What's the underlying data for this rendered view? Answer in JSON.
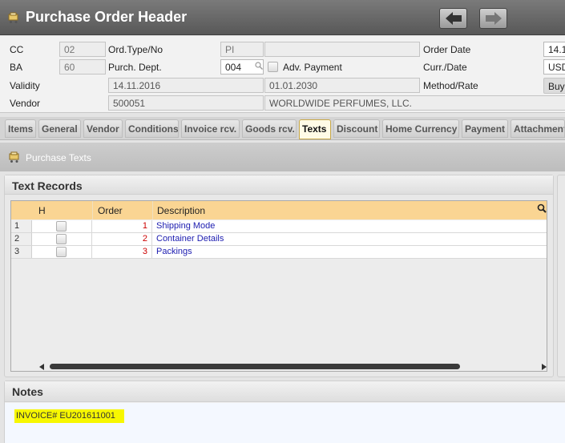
{
  "window": {
    "title": "Purchase Order Header",
    "back_icon": "arrow-left-icon",
    "forward_icon": "arrow-right-icon"
  },
  "header": {
    "cc_label": "CC",
    "cc_value": "02",
    "ba_label": "BA",
    "ba_value": "60",
    "ord_type_label": "Ord.Type/No",
    "ord_type_value": "PI",
    "ord_no_value": "",
    "purch_dept_label": "Purch. Dept.",
    "purch_dept_value": "004",
    "adv_payment_label": "Adv. Payment",
    "order_date_label": "Order Date",
    "order_date_value": "14.1",
    "curr_date_label": "Curr./Date",
    "curr_value": "USD",
    "validity_label": "Validity",
    "validity_from": "14.11.2016",
    "validity_to": "01.01.2030",
    "method_rate_label": "Method/Rate",
    "method_value": "Buy",
    "vendor_label": "Vendor",
    "vendor_code": "500051",
    "vendor_name": "WORLDWIDE PERFUMES, LLC."
  },
  "tabs": [
    {
      "label": "Items"
    },
    {
      "label": "General"
    },
    {
      "label": "Vendor"
    },
    {
      "label": "Conditions"
    },
    {
      "label": "Invoice rcv."
    },
    {
      "label": "Goods rcv."
    },
    {
      "label": "Texts",
      "active": true
    },
    {
      "label": "Discount"
    },
    {
      "label": "Home Currency"
    },
    {
      "label": "Payment"
    },
    {
      "label": "Attachment"
    }
  ],
  "section": {
    "title": "Purchase Texts"
  },
  "text_records": {
    "title": "Text Records",
    "columns": [
      "H",
      "Order",
      "Description"
    ],
    "rows": [
      {
        "num": "1",
        "order": "1",
        "description": "Shipping Mode"
      },
      {
        "num": "2",
        "order": "2",
        "description": "Container Details"
      },
      {
        "num": "3",
        "order": "3",
        "description": "Packings"
      }
    ]
  },
  "notes": {
    "title": "Notes",
    "text": "INVOICE# EU201611001",
    "highlight_color": "#f7f700"
  },
  "colors": {
    "grid_header": "#fad593",
    "order_value": "#cc0000",
    "description_link": "#1c1cb0"
  }
}
